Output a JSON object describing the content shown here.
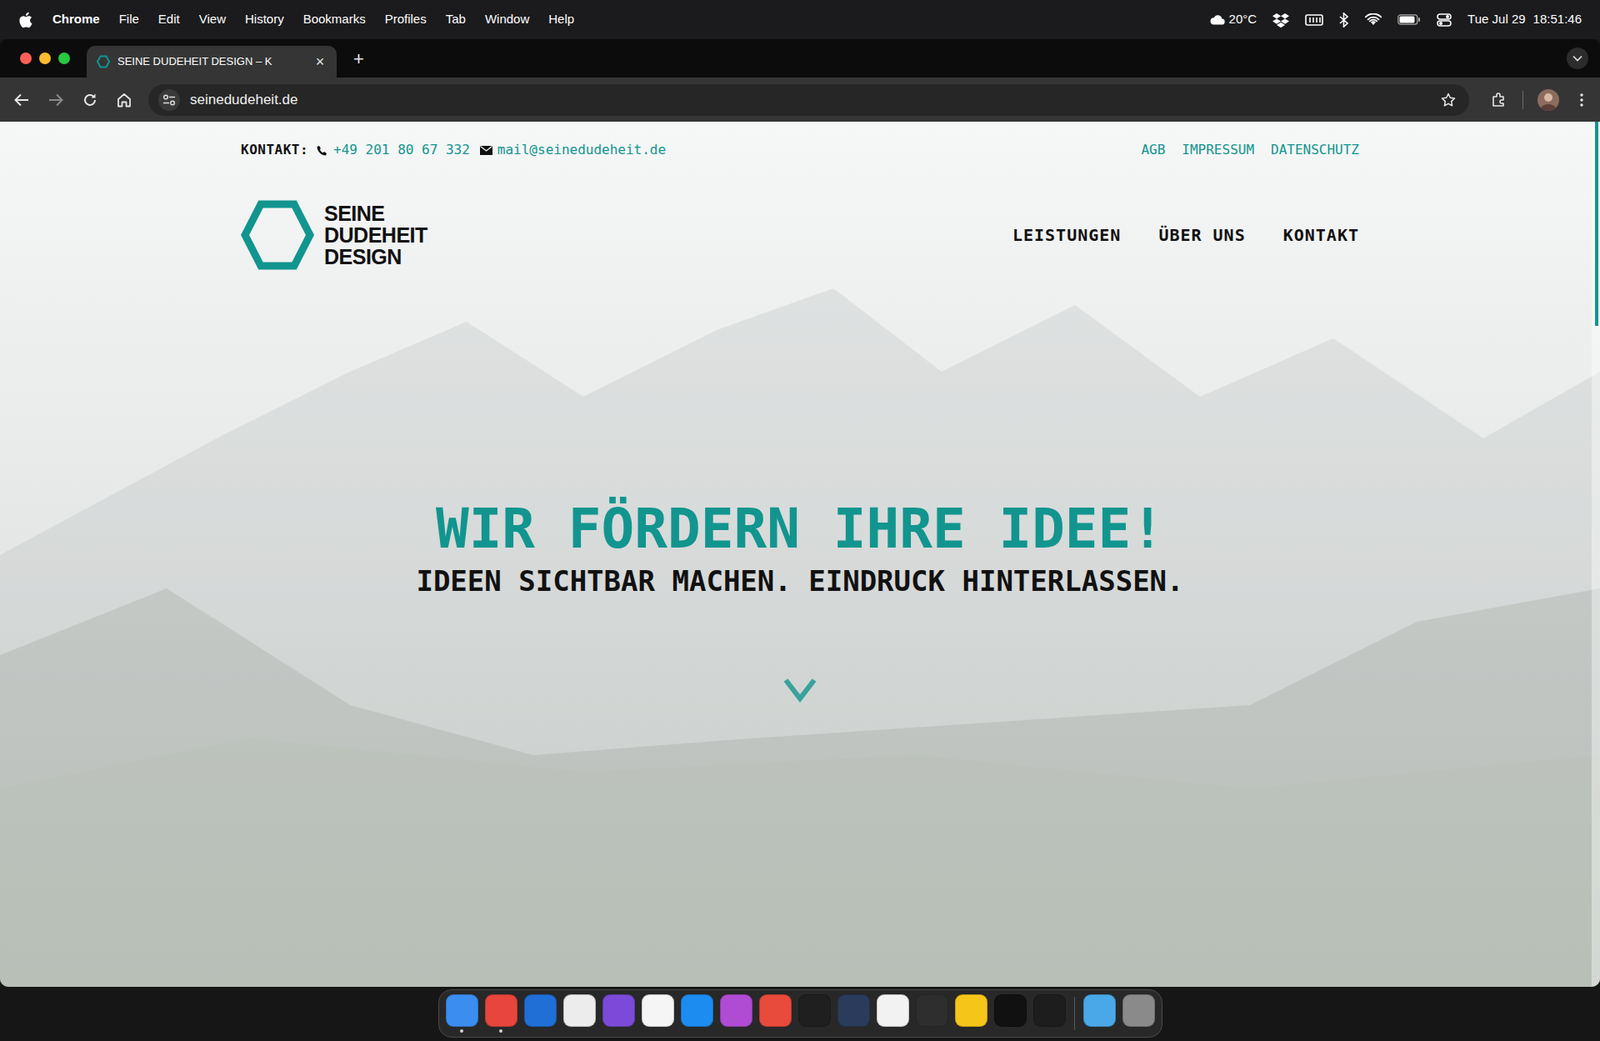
{
  "menubar": {
    "app": "Chrome",
    "items": [
      "File",
      "Edit",
      "View",
      "History",
      "Bookmarks",
      "Profiles",
      "Tab",
      "Window",
      "Help"
    ],
    "weather": "20°C",
    "date": "Tue Jul 29",
    "time": "18:51:46"
  },
  "browser": {
    "tabs": [
      {
        "label": "SEINE DUDEHEIT DESIGN – K",
        "selected": true,
        "close": "×"
      }
    ],
    "new_tab": "+",
    "url": "seinedudeheit.de"
  },
  "page": {
    "contact_label": "KONTAKT:",
    "phone": "+49 201 80 67 332",
    "email": "mail@seinedudeheit.de",
    "legal_links": [
      "AGB",
      "IMPRESSUM",
      "DATENSCHUTZ"
    ],
    "logo_lines": [
      "SEINE",
      "DUDEHEIT",
      "DESIGN"
    ],
    "nav": [
      "LEISTUNGEN",
      "ÜBER UNS",
      "KONTAKT"
    ],
    "headline": "WIR FÖRDERN IHRE IDEE!",
    "subline": "IDEEN SICHTBAR MACHEN. EINDRUCK HINTERLASSEN."
  },
  "dock": {
    "apps": [
      {
        "running": true,
        "color": "#3a8ef0"
      },
      {
        "running": true,
        "color": "#e8453c"
      },
      {
        "running": false,
        "color": "#1f6fd6"
      },
      {
        "running": false,
        "color": "#ececec"
      },
      {
        "running": false,
        "color": "#7b4ad9"
      },
      {
        "running": false,
        "color": "#f5f5f5"
      },
      {
        "running": false,
        "color": "#1c8cf0"
      },
      {
        "running": false,
        "color": "#b04bd4"
      },
      {
        "running": false,
        "color": "#e84a3b"
      },
      {
        "running": false,
        "color": "#1f1f1f"
      },
      {
        "running": false,
        "color": "#2b3b5c"
      },
      {
        "running": false,
        "color": "#f2f2f2"
      },
      {
        "running": false,
        "color": "#2e2e2e"
      },
      {
        "running": false,
        "color": "#f5c518"
      },
      {
        "running": false,
        "color": "#111111"
      },
      {
        "running": false,
        "color": "#1d1d1d"
      }
    ],
    "stack": [
      {
        "running": false,
        "color": "#4aa8e8"
      },
      {
        "running": false,
        "color": "#8a8a8a"
      }
    ]
  }
}
